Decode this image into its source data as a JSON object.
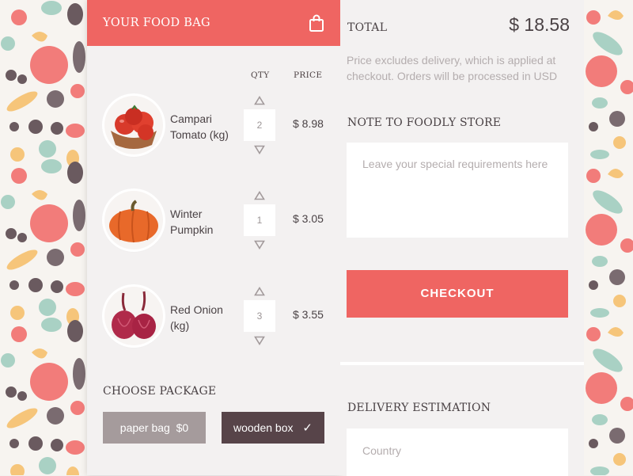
{
  "cart": {
    "title": "YOUR FOOD BAG",
    "qty_header": "QTY",
    "price_header": "PRICE",
    "items": [
      {
        "name": "Campari Tomato (kg)",
        "qty": "2",
        "price": "$ 8.98"
      },
      {
        "name": "Winter Pumpkin",
        "qty": "1",
        "price": "$ 3.05"
      },
      {
        "name": "Red Onion (kg)",
        "qty": "3",
        "price": "$ 3.55"
      }
    ],
    "package_title": "CHOOSE PACKAGE",
    "package_options": [
      {
        "label": "paper bag",
        "price": "$0"
      },
      {
        "label": "wooden box",
        "check": "✓"
      }
    ]
  },
  "summary": {
    "total_label": "TOTAL",
    "total_value": "$ 18.58",
    "price_note": "Price excludes delivery, which is applied at checkout. Orders will be processed in USD",
    "note_title": "NOTE TO FOODLY STORE",
    "note_placeholder": "Leave your special requirements here",
    "checkout_label": "CHECKOUT",
    "delivery_title": "DELIVERY ESTIMATION",
    "country_placeholder": "Country"
  },
  "colors": {
    "accent": "#ef6562",
    "dark": "#574449",
    "muted": "#a59b9c",
    "panel": "#f3f1f1"
  },
  "icons": {
    "bag": "shopping-bag-icon",
    "up": "triangle-up-icon",
    "down": "triangle-down-icon",
    "check": "checkmark-icon"
  }
}
